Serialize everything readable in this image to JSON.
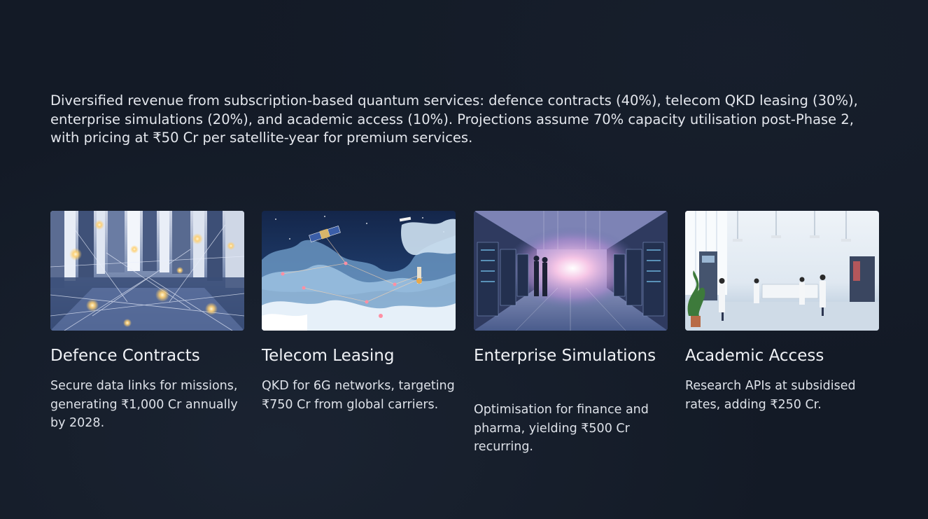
{
  "intro": {
    "text": "Diversified revenue from subscription-based quantum services: defence contracts (40%), telecom QKD leasing (30%), enterprise simulations (20%), and academic access (10%). Projections assume 70% capacity utilisation post-Phase 2, with pricing at ₹50 Cr per satellite-year for premium services."
  },
  "cards": [
    {
      "title": "Defence Contracts",
      "description": "Secure data links for missions, generating ₹1,000 Cr annually by 2028.",
      "image": "quantum-network-corridor-illustration"
    },
    {
      "title": "Telecom Leasing",
      "description": "QKD for 6G networks, targeting ₹750 Cr from global carriers.",
      "image": "satellites-over-clouds-illustration"
    },
    {
      "title": "Enterprise Simulations",
      "description": "Optimisation for finance and pharma, yielding ₹500 Cr recurring.",
      "image": "data-center-illustration"
    },
    {
      "title": "Academic Access",
      "description": "Research APIs at subsidised rates, adding ₹250 Cr.",
      "image": "research-lab-illustration"
    }
  ],
  "colors": {
    "background": "#131a26",
    "text": "#e4e7ed",
    "accent_glow": "#ffd27a",
    "pink_glow": "#f2a6d8"
  }
}
